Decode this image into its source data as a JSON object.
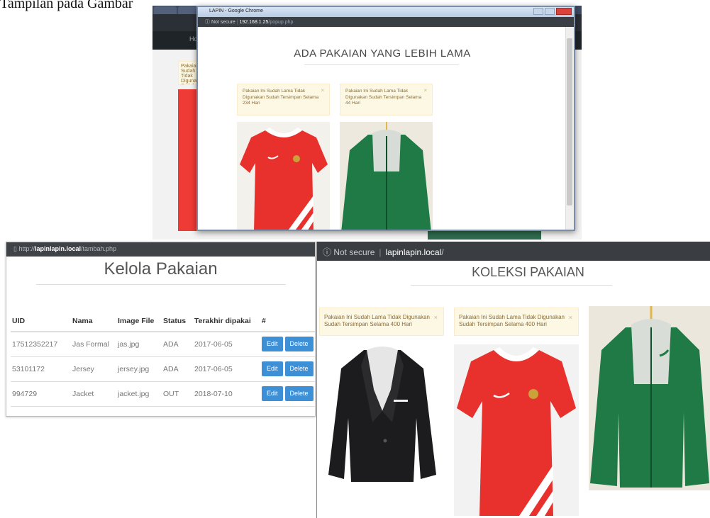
{
  "caption": "Tampilan pada Gambar",
  "top_screenshot": {
    "window_title": "LAPIN - Google Chrome",
    "address": {
      "security": "Not secure",
      "ip": "192.168.1.25",
      "path": "/popup.php"
    },
    "background_nav_label": "Home",
    "background_alert_text": "Pakaian Ini Sudah Lama Tidak Digunakan Sudah Tersimpan",
    "heading": "ADA PAKAIAN YANG LEBIH LAMA",
    "alerts": [
      {
        "text": "Pakaian Ini Sudah Lama Tidak Digunakan Sudah Tersimpan Selama 234 Hari",
        "close": "×"
      },
      {
        "text": "Pakaian Ini Sudah Lama Tidak Digunakan Sudah Tersimpan Selama 44 Hari",
        "close": "×"
      }
    ],
    "images": [
      "red-jersey-photo",
      "green-jacket-photo"
    ]
  },
  "kelola": {
    "address": {
      "scheme": "http://",
      "host": "lapinlapin.local",
      "path": "/tambah.php"
    },
    "title": "Kelola Pakaian",
    "columns": [
      "UID",
      "Nama",
      "Image File",
      "Status",
      "Terakhir dipakai",
      "#"
    ],
    "rows": [
      {
        "uid": "17512352217",
        "nama": "Jas Formal",
        "file": "jas.jpg",
        "status": "ADA",
        "date": "2017-06-05",
        "edit": "Edit",
        "delete": "Delete"
      },
      {
        "uid": "53101172",
        "nama": "Jersey",
        "file": "jersey.jpg",
        "status": "ADA",
        "date": "2017-06-05",
        "edit": "Edit",
        "delete": "Delete"
      },
      {
        "uid": "994729",
        "nama": "Jacket",
        "file": "jacket.jpg",
        "status": "OUT",
        "date": "2018-07-10",
        "edit": "Edit",
        "delete": "Delete"
      }
    ]
  },
  "koleksi": {
    "address": {
      "security": "Not secure",
      "host": "lapinlapin.local",
      "path": "/"
    },
    "heading": "KOLEKSI PAKAIAN",
    "alerts": [
      {
        "text": "Pakaian Ini Sudah Lama Tidak Digunakan Sudah Tersimpan Selama 400 Hari",
        "close": "×"
      },
      {
        "text": "Pakaian Ini Sudah Lama Tidak Digunakan Sudah Tersimpan Selama 400 Hari",
        "close": "×"
      }
    ],
    "images": [
      "black-blazer-photo",
      "red-jersey-photo",
      "green-jacket-photo"
    ]
  },
  "colors": {
    "alert_bg": "#fcf8e3",
    "alert_text": "#8a6d3b",
    "button": "#3d8fd6",
    "jersey_red": "#e8312c",
    "jacket_green": "#1f7a45"
  }
}
